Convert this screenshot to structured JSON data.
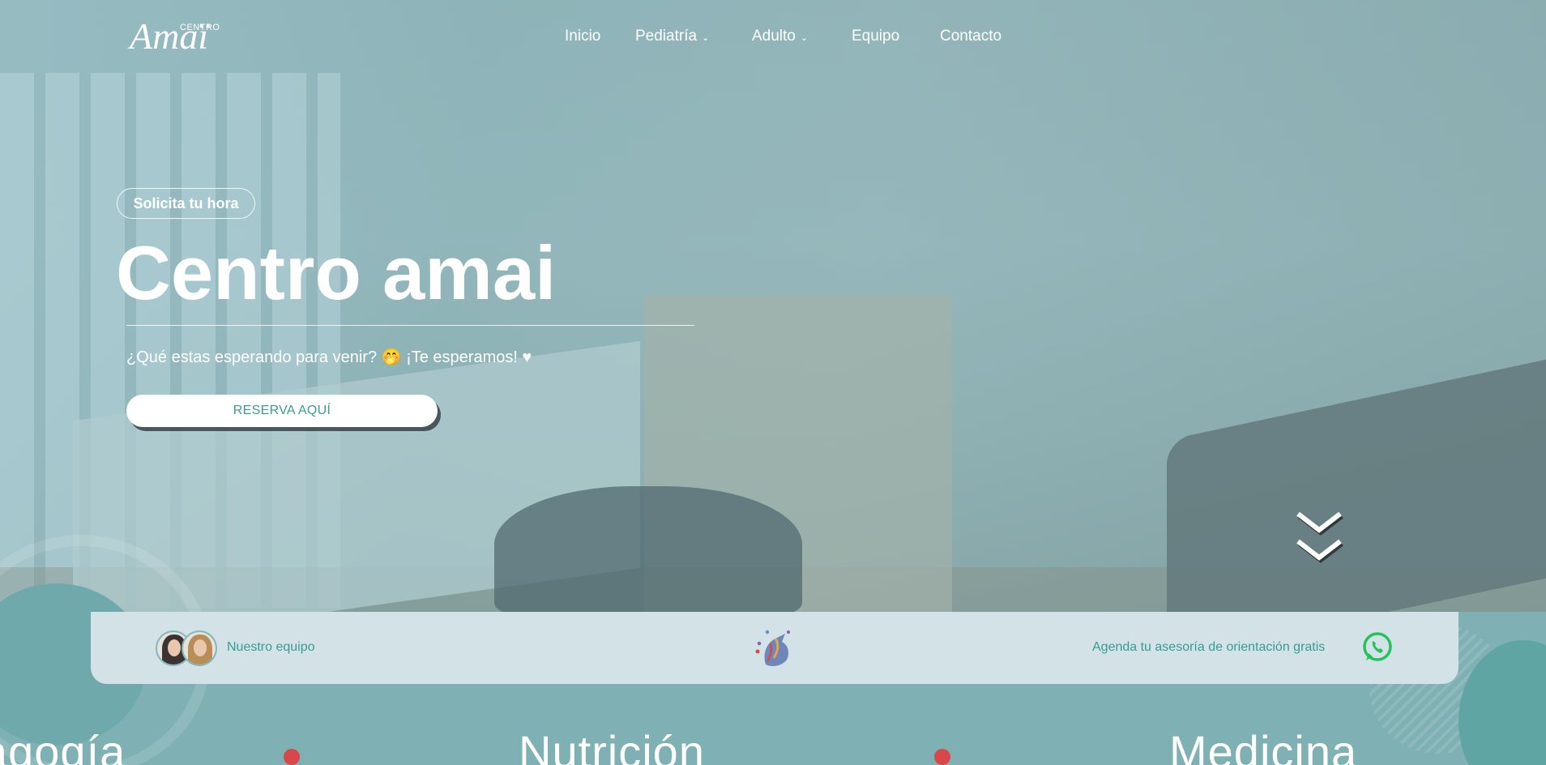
{
  "brand": {
    "logo_small": "CENTRO",
    "logo_big": "Amaï"
  },
  "nav": {
    "items": [
      {
        "label": "Inicio"
      },
      {
        "label": "Pediatría",
        "chevron": "chevron-down-icon"
      },
      {
        "label": "Adulto",
        "chevron": "chevron-down-icon"
      },
      {
        "label": "Equipo"
      },
      {
        "label": "Contacto"
      }
    ]
  },
  "hero": {
    "pill": "Solicita tu hora",
    "title": "Centro amai",
    "subtitle": "¿Qué estas esperando para venir? 🤭 ¡Te esperamos! ♥",
    "cta": "RESERVA AQUÍ",
    "scroll_icon": "double-chevron-down-icon"
  },
  "bar": {
    "team_label": "Nuestro equipo",
    "emblem_icon": "unicorn-logo",
    "advice_label": "Agenda tu asesoría de orientación gratis",
    "whatsapp_icon": "whatsapp-icon"
  },
  "services": [
    {
      "label": "agogía"
    },
    {
      "label": "Nutrición"
    },
    {
      "label": "Medicina"
    }
  ],
  "colors": {
    "accent": "#3a9b95",
    "bar_bg": "#d3e2e6",
    "dot": "#d9474b",
    "page_bg": "#7fb0b4"
  }
}
